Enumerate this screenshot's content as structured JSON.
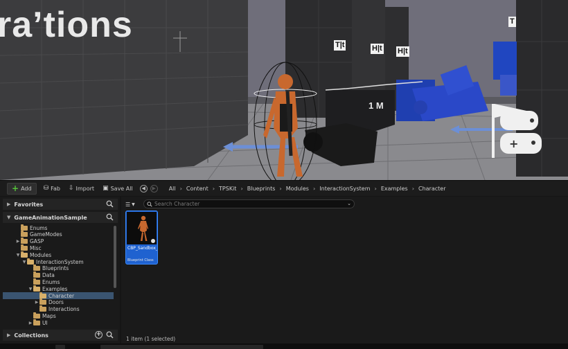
{
  "viewport": {
    "sign_text": "ra’tions",
    "box_labels": [
      "T|t",
      "H|t",
      "H|t",
      "T"
    ],
    "distance_label": "1 M"
  },
  "toolbar": {
    "add_label": "Add",
    "fab_label": "Fab",
    "import_label": "Import",
    "save_all_label": "Save All"
  },
  "breadcrumb": [
    "All",
    "Content",
    "TPSKit",
    "Blueprints",
    "Modules",
    "InteractionSystem",
    "Examples",
    "Character"
  ],
  "left_panel": {
    "favorites": "Favorites",
    "root": "GameAnimationSample",
    "collections": "Collections",
    "tree": [
      {
        "label": "Enums",
        "indent": 1,
        "caret": "",
        "open": false
      },
      {
        "label": "GameModes",
        "indent": 1,
        "caret": "",
        "open": false
      },
      {
        "label": "GASP",
        "indent": 1,
        "caret": "▶",
        "open": false
      },
      {
        "label": "Misc",
        "indent": 1,
        "caret": "",
        "open": false
      },
      {
        "label": "Modules",
        "indent": 1,
        "caret": "▼",
        "open": true
      },
      {
        "label": "InteractionSystem",
        "indent": 2,
        "caret": "▼",
        "open": true
      },
      {
        "label": "Blueprints",
        "indent": 3,
        "caret": "",
        "open": false
      },
      {
        "label": "Data",
        "indent": 3,
        "caret": "",
        "open": false
      },
      {
        "label": "Enums",
        "indent": 3,
        "caret": "",
        "open": false
      },
      {
        "label": "Examples",
        "indent": 3,
        "caret": "▼",
        "open": true
      },
      {
        "label": "Character",
        "indent": 4,
        "caret": "",
        "open": true,
        "selected": true
      },
      {
        "label": "Doors",
        "indent": 4,
        "caret": "▶",
        "open": false
      },
      {
        "label": "Interactions",
        "indent": 4,
        "caret": "",
        "open": false
      },
      {
        "label": "Maps",
        "indent": 3,
        "caret": "",
        "open": false
      },
      {
        "label": "UI",
        "indent": 3,
        "caret": "▶",
        "open": false
      }
    ]
  },
  "content": {
    "search_placeholder": "Search Character",
    "asset": {
      "name": "CBP_Sandbox_Shooter_...",
      "type": "Blueprint Class"
    },
    "status": "1 item (1 selected)"
  },
  "colors": {
    "accent": "#1f62d0",
    "selected_row": "#3a5470",
    "add_icon": "#55c23a",
    "folder": "#c9a05c"
  }
}
